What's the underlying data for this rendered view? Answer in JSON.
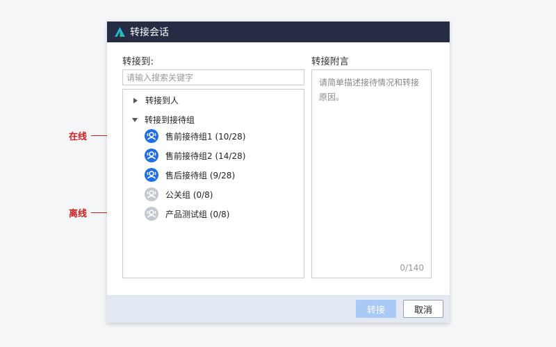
{
  "dialog": {
    "title": "转接会话",
    "transfer_to_label": "转接到:",
    "search": {
      "placeholder": "请输入搜索关键字",
      "value": ""
    },
    "tree": {
      "nodes": [
        {
          "label": "转接到人",
          "expanded": false
        },
        {
          "label": "转接到接待组",
          "expanded": true
        }
      ],
      "groups": [
        {
          "label": "售前接待组1 (10/28)",
          "status": "online"
        },
        {
          "label": "售前接待组2 (14/28)",
          "status": "online"
        },
        {
          "label": "售后接待组 (9/28)",
          "status": "online"
        },
        {
          "label": "公关组 (0/8)",
          "status": "offline"
        },
        {
          "label": "产品测试组  (0/8)",
          "status": "offline"
        }
      ]
    },
    "note": {
      "label": "转接附言",
      "placeholder": "请简单描述接待情况和转接原因。",
      "counter": "0/140"
    },
    "buttons": {
      "confirm": "转接",
      "cancel": "取消"
    }
  },
  "annotations": {
    "online": "在线",
    "offline": "离线"
  },
  "colors": {
    "titlebar": "#252c44",
    "online_icon": "#1f6fe8",
    "offline_icon": "#c4c8d0",
    "footer": "#e3e9f2",
    "confirm_disabled": "#a9c9f6",
    "annotation": "#d0201c",
    "logo": "#1fb8d8"
  }
}
